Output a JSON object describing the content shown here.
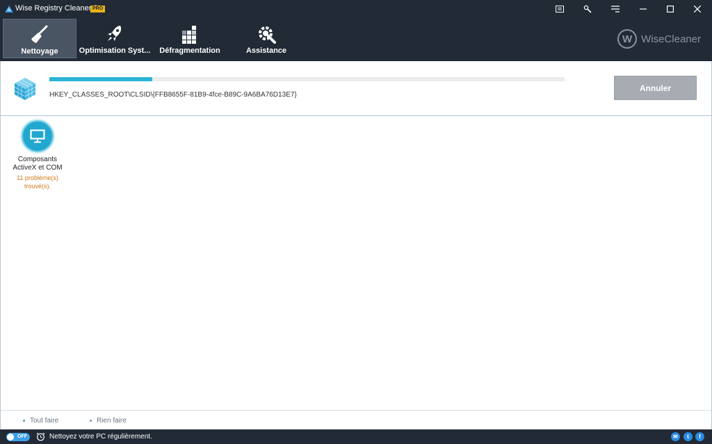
{
  "window": {
    "title": "Wise Registry Cleaner 9",
    "badge": "PRO",
    "controls": [
      "message-icon",
      "tools-icon",
      "menu-icon",
      "minimize-icon",
      "maximize-icon",
      "close-icon"
    ]
  },
  "toolbar": {
    "tabs": [
      {
        "label": "Nettoyage",
        "icon": "broom-icon",
        "active": true
      },
      {
        "label": "Optimisation Syst...",
        "icon": "rocket-icon",
        "active": false
      },
      {
        "label": "Défragmentation",
        "icon": "defrag-blocks-icon",
        "active": false
      },
      {
        "label": "Assistance",
        "icon": "wrench-gear-icon",
        "active": false
      }
    ],
    "brand": {
      "mark": "W",
      "name": "WiseCleaner"
    }
  },
  "scan": {
    "progress": 0.2,
    "path": "HKEY_CLASSES_ROOT\\CLSID\\{FFB8655F-81B9-4fce-B89C-9A6BA76D13E7}",
    "cancel_label": "Annuler"
  },
  "categories": [
    {
      "name": "Composants ActiveX et COM",
      "issues": "11 problème(s) trouvé(s).",
      "icon": "monitor-icon"
    }
  ],
  "actions": {
    "select_all": "Tout faire",
    "select_none": "Rien faire"
  },
  "statusbar": {
    "toggle_label": "OFF",
    "message": "Nettoyez votre PC régulièrement.",
    "social": [
      "mail-icon",
      "twitter-icon",
      "facebook-icon"
    ]
  },
  "colors": {
    "chrome": "#222a36",
    "accent": "#2cb4d6",
    "issue_text": "#d07a1a",
    "cancel_button": "#a7acb3"
  }
}
